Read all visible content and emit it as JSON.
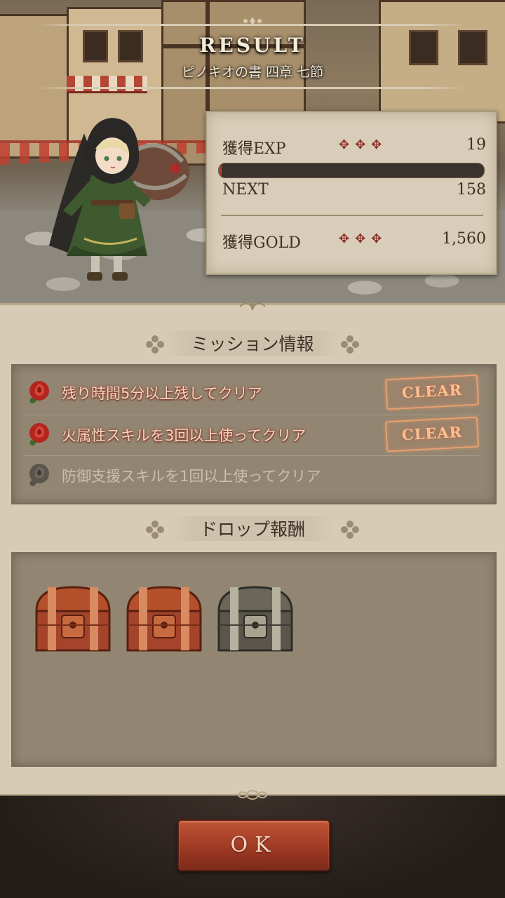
{
  "header": {
    "title": "RESULT",
    "subtitle": "ピノキオの書 四章 七節"
  },
  "stats": {
    "exp_label": "獲得EXP",
    "exp_dots": "✥✥✥",
    "exp_value": "19",
    "exp_progress": 0.01,
    "next_label": "NEXT",
    "next_value": "158",
    "gold_label": "獲得GOLD",
    "gold_dots": "✥✥✥",
    "gold_value": "1,560"
  },
  "missions": {
    "title": "ミッション情報",
    "items": [
      {
        "text": "残り時間5分以上残してクリア",
        "status": "CLEAR",
        "cleared": true
      },
      {
        "text": "火属性スキルを3回以上使ってクリア",
        "status": "CLEAR",
        "cleared": true
      },
      {
        "text": "防御支援スキルを1回以上使ってクリア",
        "status": "",
        "cleared": false
      }
    ]
  },
  "drops": {
    "title": "ドロップ報酬",
    "items": [
      {
        "icon": "red-treasure-chest-icon"
      },
      {
        "icon": "red-treasure-chest-icon"
      },
      {
        "icon": "iron-treasure-chest-icon"
      }
    ]
  },
  "footer": {
    "ok_label": "OK"
  },
  "colors": {
    "accent_red": "#9e3a24",
    "panel_bg": "#d7cbb6",
    "clear_badge": "#e8a070"
  }
}
